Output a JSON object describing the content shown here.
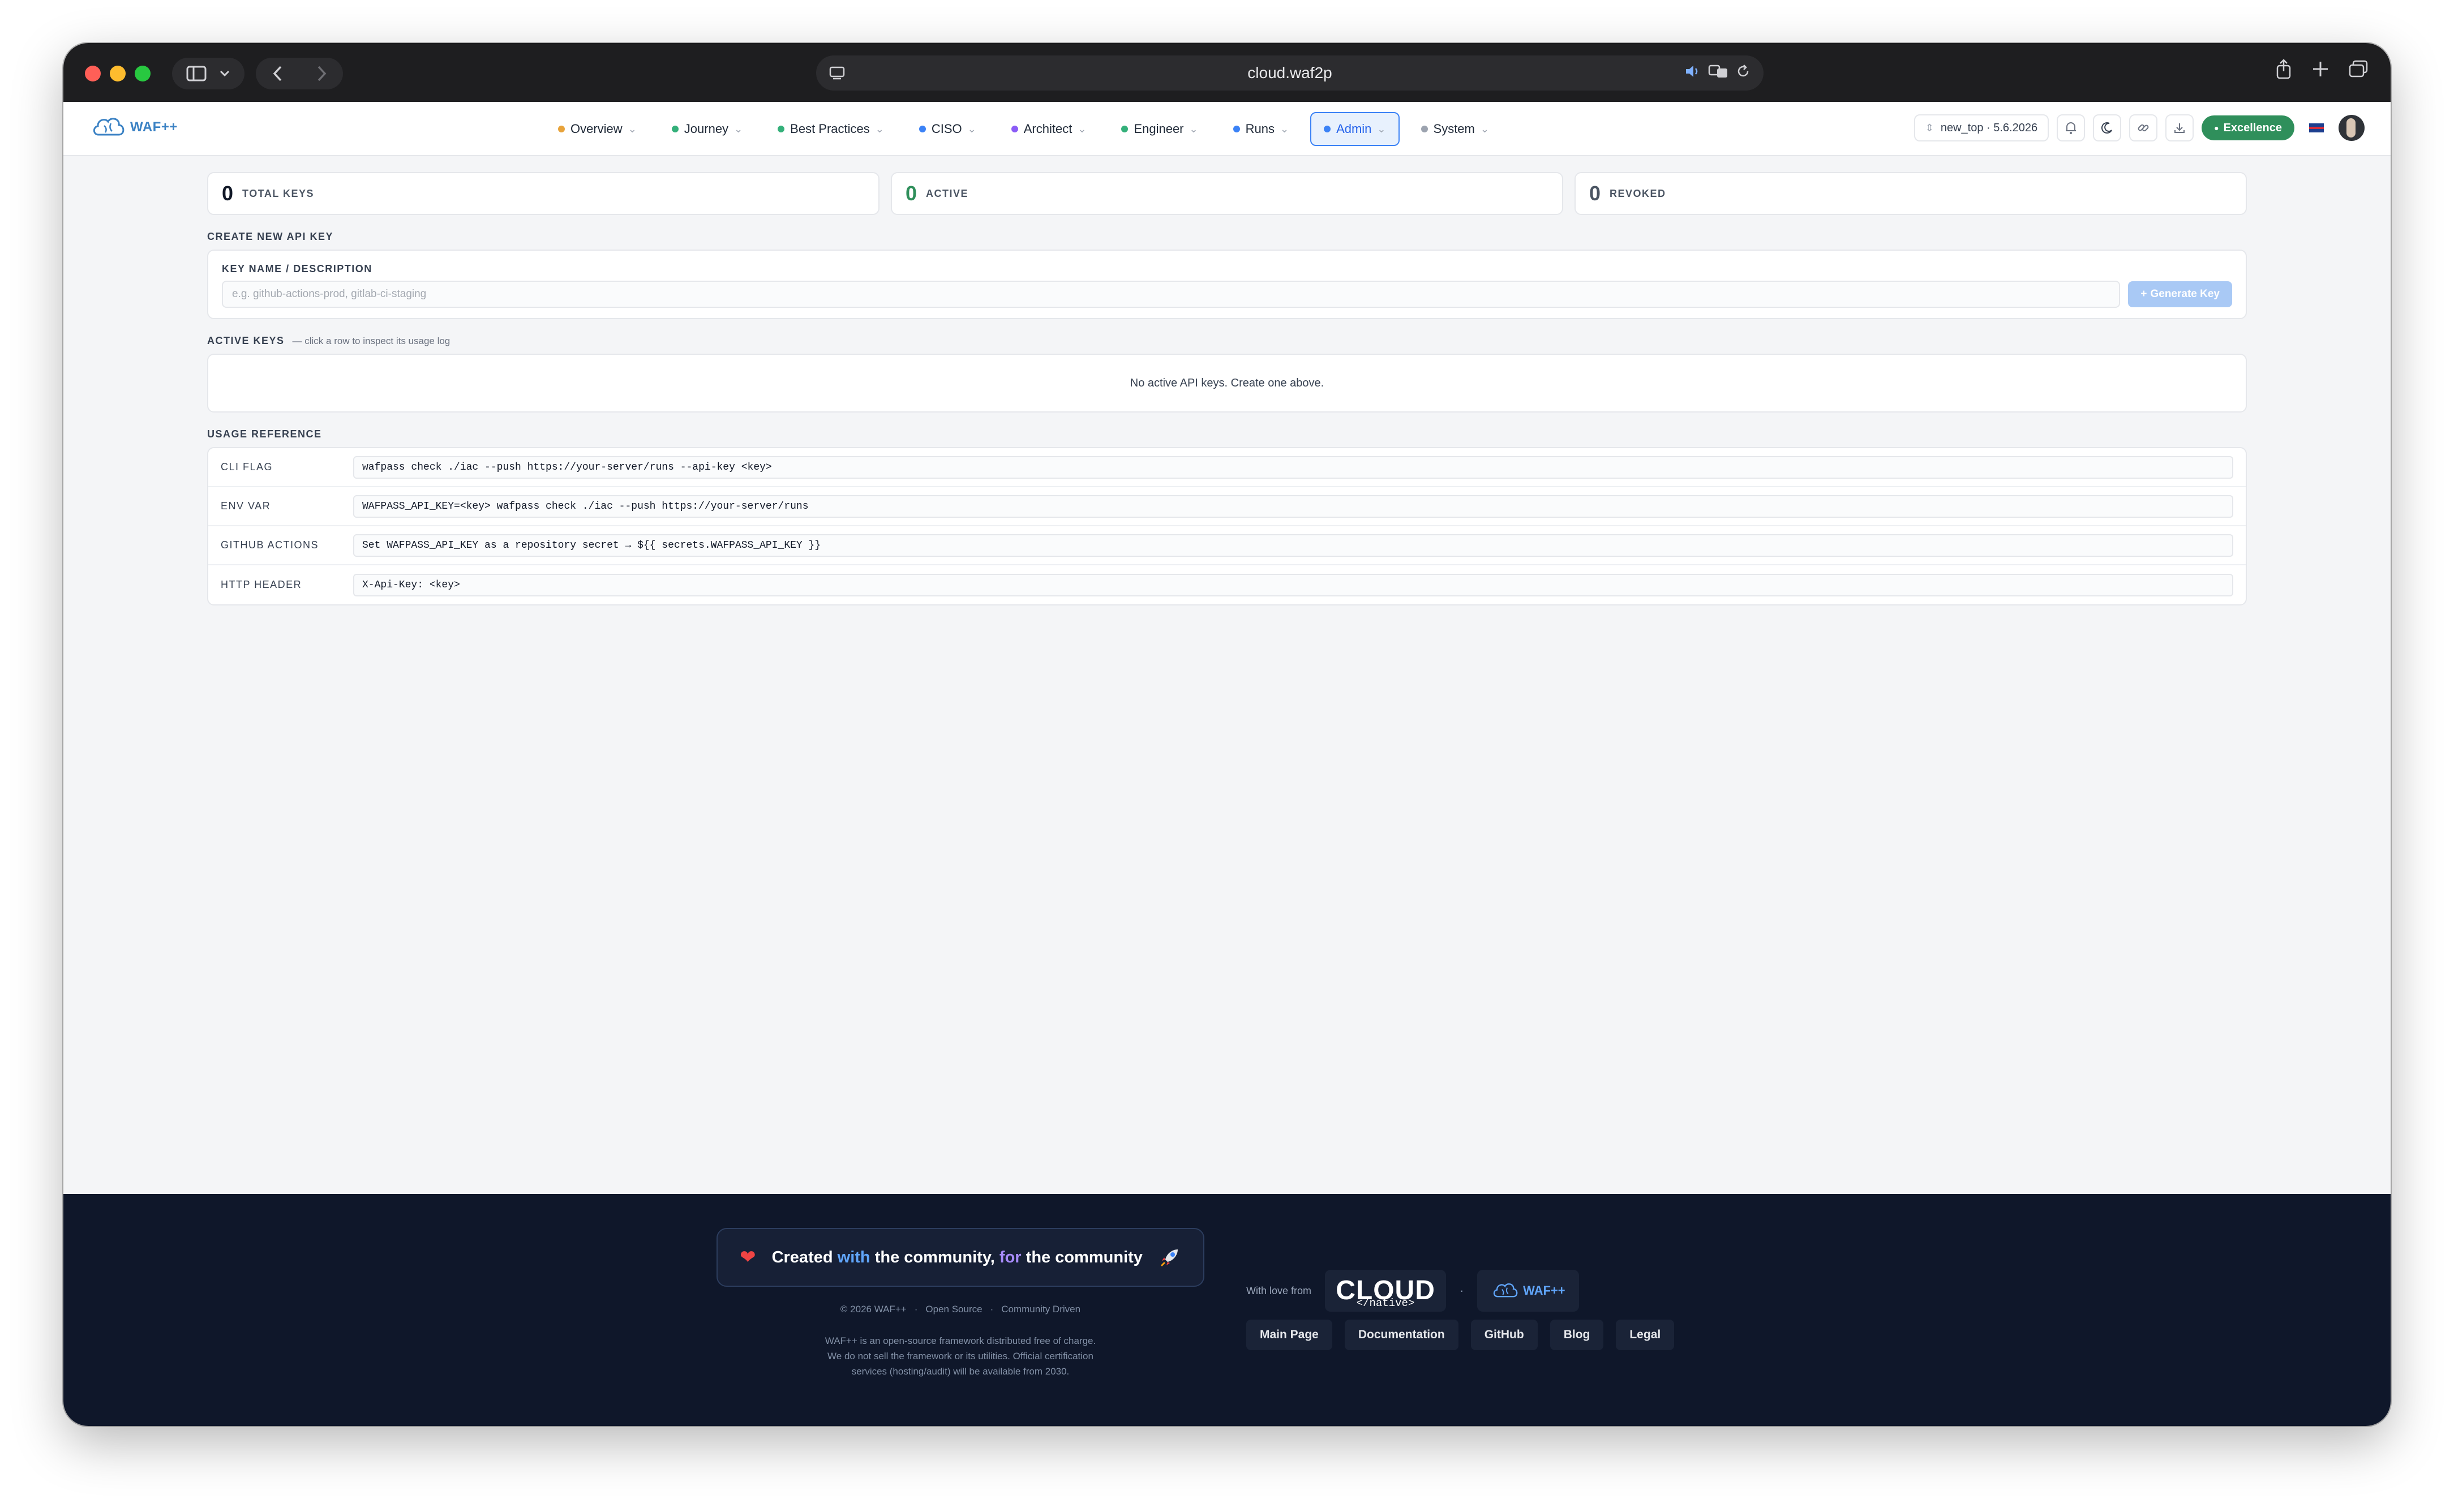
{
  "browser": {
    "url": "cloud.waf2p"
  },
  "app": {
    "logo_text": "WAF++",
    "nav": [
      {
        "label": "Overview",
        "color": "#e8a33b"
      },
      {
        "label": "Journey",
        "color": "#34b07a"
      },
      {
        "label": "Best Practices",
        "color": "#34b07a"
      },
      {
        "label": "CISO",
        "color": "#3b82f6"
      },
      {
        "label": "Architect",
        "color": "#8b5cf6"
      },
      {
        "label": "Engineer",
        "color": "#34b07a"
      },
      {
        "label": "Runs",
        "color": "#3b82f6"
      },
      {
        "label": "Admin",
        "color": "#3b82f6"
      },
      {
        "label": "System",
        "color": "#9ca3af"
      }
    ],
    "active_nav": "Admin",
    "branch": "new_top · 5.6.2026",
    "excellence_label": "Excellence",
    "accent_color": "#3b82f6",
    "success_color": "#2f8f5b"
  },
  "stats": [
    {
      "value": "0",
      "label": "TOTAL KEYS",
      "color": "#111827"
    },
    {
      "value": "0",
      "label": "ACTIVE",
      "color": "#2f8f5b"
    },
    {
      "value": "0",
      "label": "REVOKED",
      "color": "#4b5563"
    }
  ],
  "create": {
    "section_title": "CREATE NEW API KEY",
    "field_label": "KEY NAME / DESCRIPTION",
    "input_value": "",
    "input_placeholder": "e.g. github-actions-prod, gitlab-ci-staging",
    "button_label": "Generate Key",
    "button_icon": "+"
  },
  "active_keys": {
    "section_title": "ACTIVE KEYS",
    "hint": "— click a row to inspect its usage log",
    "empty_text": "No active API keys. Create one above."
  },
  "usage": {
    "section_title": "USAGE REFERENCE",
    "rows": [
      {
        "key": "CLI FLAG",
        "value": "wafpass check ./iac --push https://your-server/runs --api-key <key>"
      },
      {
        "key": "ENV VAR",
        "value": "WAFPASS_API_KEY=<key> wafpass check ./iac --push https://your-server/runs"
      },
      {
        "key": "GITHUB ACTIONS",
        "value": "Set WAFPASS_API_KEY as a repository secret → ${{ secrets.WAFPASS_API_KEY }}"
      },
      {
        "key": "HTTP HEADER",
        "value": "X-Api-Key: <key>"
      }
    ]
  },
  "footer": {
    "banner_part1": "Created",
    "banner_with": "with",
    "banner_part2": "the community,",
    "banner_for": "for",
    "banner_part3": "the community",
    "copyright": "© 2026 WAF++",
    "open_source": "Open Source",
    "community": "Community Driven",
    "description": "WAF++ is an open-source framework distributed free of charge. We do not sell the framework or its utilities. Official certification services (hosting/audit) will be available from 2030.",
    "love_label": "With love from",
    "cn_logo_big": "CLOUD",
    "cn_logo_small": "</native>",
    "waf_logo": "WAF++",
    "links": [
      "Main Page",
      "Documentation",
      "GitHub",
      "Blog",
      "Legal"
    ]
  }
}
